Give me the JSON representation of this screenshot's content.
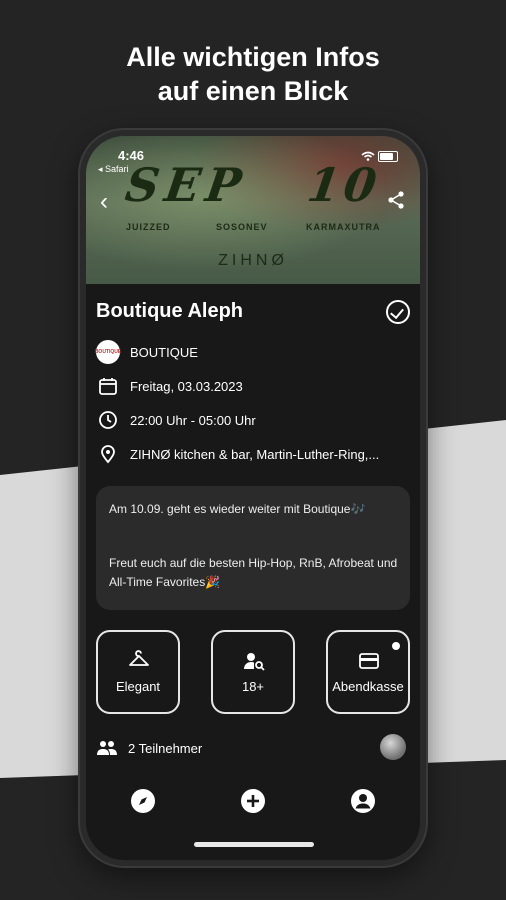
{
  "promo": {
    "line1": "Alle wichtigen Infos",
    "line2": "auf einen Blick"
  },
  "status_bar": {
    "time": "4:46",
    "back_app": "◂ Safari"
  },
  "banner": {
    "month": "SEP",
    "day": "10",
    "artists": [
      "JUIZZED",
      "SOSONEV",
      "KARMAXUTRA"
    ],
    "venue_logo": "ZIHNØ"
  },
  "event": {
    "title": "Boutique Aleph",
    "organizer": "BOUTIQUE",
    "organizer_logo_text": "BOUTIQUE",
    "date": "Freitag, 03.03.2023",
    "time": "22:00 Uhr - 05:00 Uhr",
    "location": "ZIHNØ kitchen & bar, Martin-Luther-Ring,..."
  },
  "description": {
    "paragraph1": "Am 10.09. geht es wieder weiter mit Boutique🎶",
    "paragraph2": "Freut euch auf die besten Hip-Hop, RnB, Afrobeat und All-Time Favorites🎉"
  },
  "tiles": [
    {
      "label": "Elegant",
      "icon": "hanger-icon"
    },
    {
      "label": "18+",
      "icon": "person-search-icon"
    },
    {
      "label": "Abendkasse",
      "icon": "payment-card-icon"
    }
  ],
  "participants": {
    "label": "2 Teilnehmer"
  },
  "tabbar": [
    {
      "icon": "compass-icon"
    },
    {
      "icon": "add-circle-icon"
    },
    {
      "icon": "account-circle-icon"
    }
  ],
  "colors": {
    "background": "#242424",
    "stripe": "#d9d9d9",
    "screen": "#181818",
    "card": "#2b2b2b",
    "text": "#ffffff"
  }
}
